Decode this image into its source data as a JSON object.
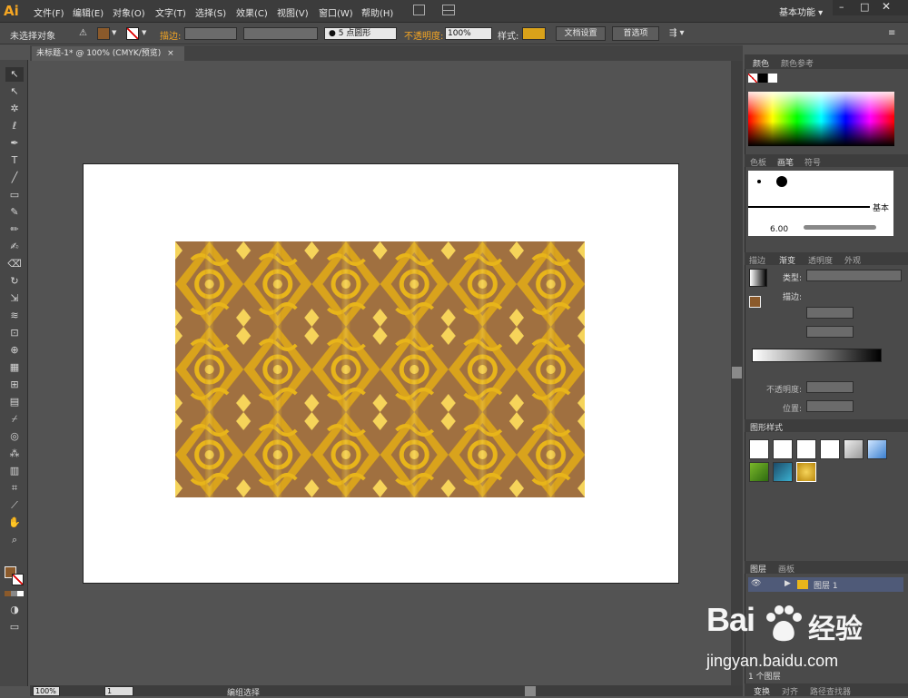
{
  "app": {
    "logo": "Ai",
    "workspace": "基本功能"
  },
  "menu": [
    "文件(F)",
    "编辑(E)",
    "对象(O)",
    "文字(T)",
    "选择(S)",
    "效果(C)",
    "视图(V)",
    "窗口(W)",
    "帮助(H)"
  ],
  "control": {
    "selection": "未选择对象",
    "stroke_label": "描边:",
    "brush": "5 点圆形",
    "opacity_label": "不透明度:",
    "opacity": "100%",
    "style_label": "样式:",
    "doc_setup": "文档设置",
    "prefs": "首选项",
    "fill_color": "#8b5a2b"
  },
  "document": {
    "tab": "未标题-1* @ 100% (CMYK/预览)",
    "close": "×"
  },
  "status": {
    "zoom": "100%",
    "page": "1",
    "mode": "编组选择"
  },
  "panels": {
    "color": {
      "tab1": "颜色",
      "tab2": "颜色参考"
    },
    "brushes": {
      "tab1": "色板",
      "tab2": "画笔",
      "tab3": "符号",
      "basic": "基本",
      "size": "6.00"
    },
    "gradient": {
      "tab1": "描边",
      "tab2": "渐变",
      "tab3": "透明度",
      "tab4": "外观",
      "type": "类型:",
      "stroke": "描边:",
      "opacity": "不透明度:",
      "location": "位置:"
    },
    "graphic_styles": {
      "tab": "图形样式"
    },
    "layers": {
      "tab1": "图层",
      "tab2": "画板",
      "layer_name": "图层 1",
      "count": "1 个图层"
    },
    "bottom": {
      "tab1": "变换",
      "tab2": "对齐",
      "tab3": "路径查找器"
    }
  },
  "watermark": {
    "brand": "Bai",
    "brand2": "经验",
    "url": "jingyan.baidu.com"
  },
  "colors": {
    "pattern_dark": "#9a6a3a",
    "pattern_gold": "#e8b51a",
    "pattern_light": "#f6d45a"
  }
}
